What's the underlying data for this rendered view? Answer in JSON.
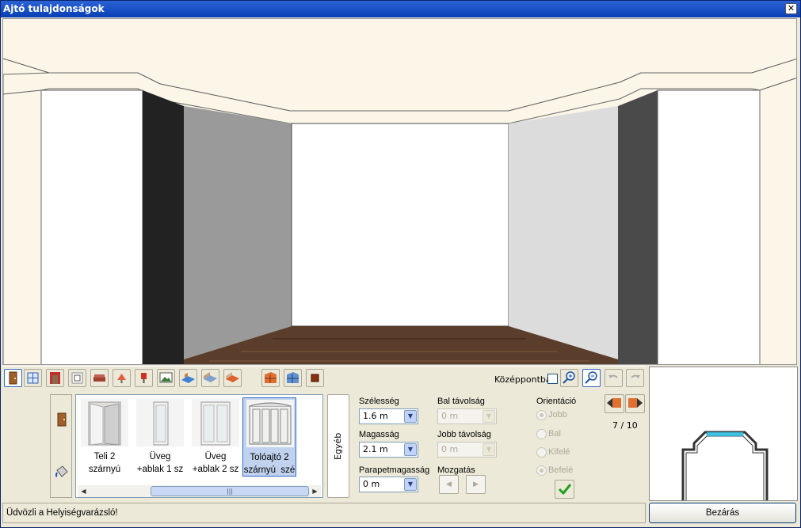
{
  "window": {
    "title": "Ajtó tulajdonságok",
    "close_icon": "close-icon"
  },
  "toolbar": {
    "center_label": "Középpontba",
    "center_checked": false,
    "tools": [
      "door-icon",
      "window-icon",
      "niche-icon",
      "frame-icon",
      "sofa-icon",
      "lamp-icon",
      "wall-lamp-icon",
      "picture-icon",
      "floor-icon",
      "room-floor-icon",
      "carpet-icon",
      "brick-wall-icon",
      "tile-wall-icon",
      "color-square-icon",
      "zoom-in-icon",
      "zoom-out-icon",
      "undo-icon",
      "redo-icon"
    ]
  },
  "gallery": {
    "items": [
      {
        "label": "Teli 2\nszárnyú",
        "selected": false
      },
      {
        "label": "Üveg\n+ablak 1 sz",
        "selected": false
      },
      {
        "label": "Üveg\n+ablak 2 sz",
        "selected": false
      },
      {
        "label": "Tolóajtó 2\nszárnyú  szé",
        "selected": true
      }
    ],
    "scroll_grip": "|||"
  },
  "tab": {
    "label": "Egyéb"
  },
  "fields": {
    "width": {
      "label": "Szélesség",
      "value": "1.6 m"
    },
    "height": {
      "label": "Magasság",
      "value": "2.1 m"
    },
    "sill": {
      "label": "Parapetmagasság",
      "value": "0 m"
    },
    "left_dist": {
      "label": "Bal távolság",
      "value": "0 m"
    },
    "right_dist": {
      "label": "Jobb távolság",
      "value": "0 m"
    },
    "move": {
      "label": "Mozgatás"
    }
  },
  "orientation": {
    "label": "Orientáció",
    "options": [
      {
        "label": "Jobb",
        "selected": true
      },
      {
        "label": "Bal",
        "selected": false
      },
      {
        "label": "Kifelé",
        "selected": false
      },
      {
        "label": "Befelé",
        "selected": true
      }
    ]
  },
  "nav": {
    "counter": "7 / 10"
  },
  "status": {
    "text": "Üdvözli a Helyiségvarázsló!"
  },
  "buttons": {
    "close": "Bezárás"
  }
}
